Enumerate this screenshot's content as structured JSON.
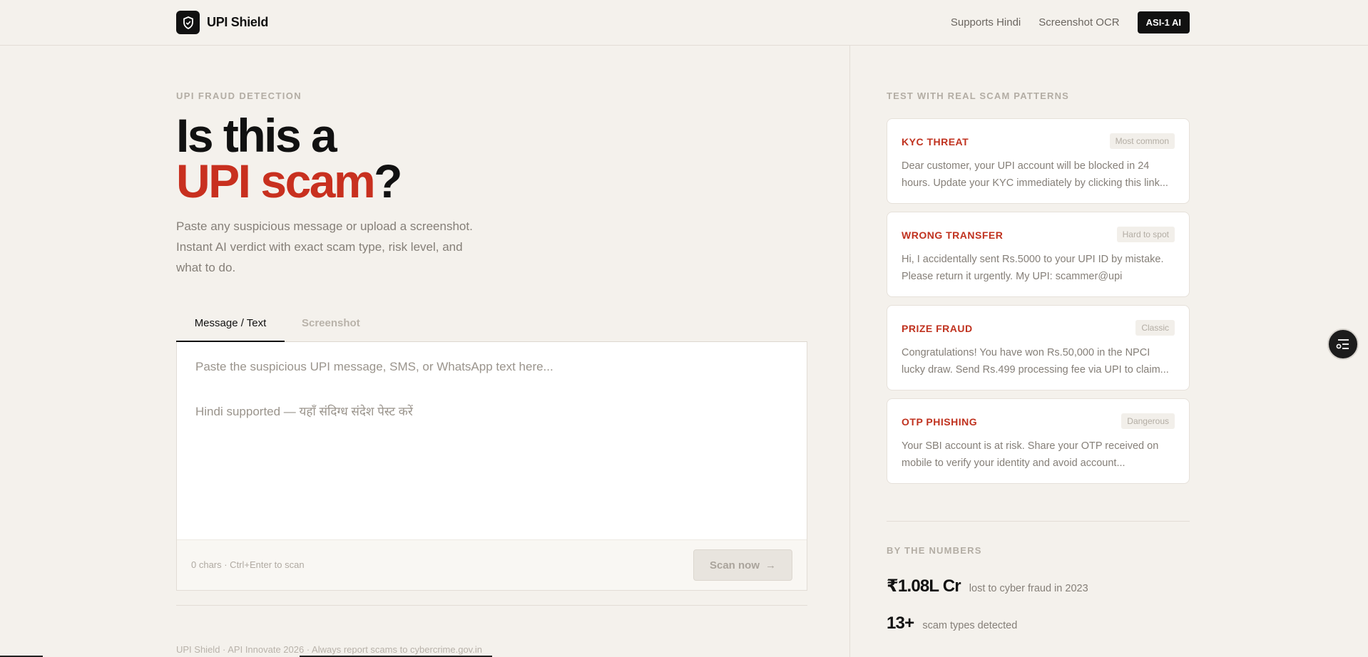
{
  "header": {
    "brand": "UPI Shield",
    "nav_links": [
      "Supports Hindi",
      "Screenshot OCR"
    ],
    "badge": "ASI-1 AI"
  },
  "main": {
    "eyebrow": "UPI FRAUD DETECTION",
    "hero_line1": "Is this a",
    "hero_accent": "UPI scam",
    "hero_suffix": "?",
    "lede": "Paste any suspicious message or upload a screenshot. Instant AI verdict with exact scam type, risk level, and what to do.",
    "tabs": [
      {
        "label": "Message / Text",
        "active": true
      },
      {
        "label": "Screenshot",
        "active": false
      }
    ],
    "editor": {
      "placeholder_line1": "Paste the suspicious UPI message, SMS, or WhatsApp text here...",
      "placeholder_line2": "Hindi supported — यहाँ संदिग्ध संदेश पेस्ट करें",
      "char_count": "0 chars · Ctrl+Enter to scan",
      "scan_label": "Scan now",
      "scan_arrow": "→"
    },
    "footer": "UPI Shield · API Innovate 2026 · Always report scams to cybercrime.gov.in"
  },
  "sidebar": {
    "eyebrow": "TEST WITH REAL SCAM PATTERNS",
    "cards": [
      {
        "title": "KYC THREAT",
        "tag": "Most common",
        "body": "Dear customer, your UPI account will be blocked in 24 hours. Update your KYC immediately by clicking this link..."
      },
      {
        "title": "WRONG TRANSFER",
        "tag": "Hard to spot",
        "body": "Hi, I accidentally sent Rs.5000 to your UPI ID by mistake. Please return it urgently. My UPI: scammer@upi"
      },
      {
        "title": "PRIZE FRAUD",
        "tag": "Classic",
        "body": "Congratulations! You have won Rs.50,000 in the NPCI lucky draw. Send Rs.499 processing fee via UPI to claim..."
      },
      {
        "title": "OTP PHISHING",
        "tag": "Dangerous",
        "body": "Your SBI account is at risk. Share your OTP received on mobile to verify your identity and avoid account..."
      }
    ],
    "stats_eyebrow": "BY THE NUMBERS",
    "stats": [
      {
        "value": "₹1.08L Cr",
        "label": "lost to cyber fraud in 2023"
      },
      {
        "value": "13+",
        "label": "scam types detected"
      }
    ]
  },
  "colors": {
    "background": "#f4f1ec",
    "accent": "#c8301f",
    "ink": "#111111"
  },
  "icons": {
    "brand": "shield-icon",
    "scan": "arrow-right-icon",
    "floating": "settings-list-icon"
  }
}
